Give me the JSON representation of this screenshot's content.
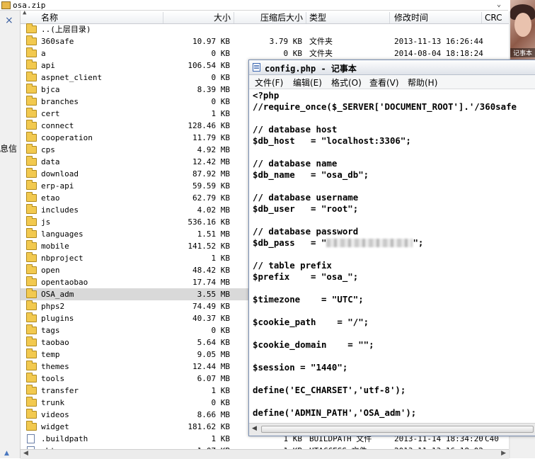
{
  "window": {
    "title": "osa.zip",
    "dropdown_icon": "chevron-down-icon"
  },
  "left_panel": {
    "close_glyph": "×",
    "partial_text": "息信",
    "arrow_glyph": "▲"
  },
  "header": {
    "up_glyph": "▲",
    "columns": [
      "名称",
      "大小",
      "压缩后大小",
      "类型",
      "修改时间",
      "CRC"
    ]
  },
  "rows": [
    {
      "name": "..(上层目录)",
      "size": "",
      "packed": "",
      "type": "",
      "mtime": "",
      "crc": ""
    },
    {
      "name": "360safe",
      "size": "10.97 KB",
      "packed": "3.79 KB",
      "type": "文件夹",
      "mtime": "2013-11-13 16:26:44",
      "crc": ""
    },
    {
      "name": "a",
      "size": "0 KB",
      "packed": "0 KB",
      "type": "文件夹",
      "mtime": "2014-08-04 18:18:24",
      "crc": ""
    },
    {
      "name": "api",
      "size": "106.54 KB",
      "packed": "",
      "type": "",
      "mtime": "",
      "crc": ""
    },
    {
      "name": "aspnet_client",
      "size": "0 KB",
      "packed": "",
      "type": "",
      "mtime": "",
      "crc": ""
    },
    {
      "name": "bjca",
      "size": "8.39 MB",
      "packed": "",
      "type": "",
      "mtime": "",
      "crc": ""
    },
    {
      "name": "branches",
      "size": "0 KB",
      "packed": "",
      "type": "",
      "mtime": "",
      "crc": ""
    },
    {
      "name": "cert",
      "size": "1 KB",
      "packed": "",
      "type": "",
      "mtime": "",
      "crc": ""
    },
    {
      "name": "connect",
      "size": "128.46 KB",
      "packed": "",
      "type": "",
      "mtime": "",
      "crc": ""
    },
    {
      "name": "cooperation",
      "size": "11.79 KB",
      "packed": "",
      "type": "",
      "mtime": "",
      "crc": ""
    },
    {
      "name": "cps",
      "size": "4.92 MB",
      "packed": "",
      "type": "",
      "mtime": "",
      "crc": ""
    },
    {
      "name": "data",
      "size": "12.42 MB",
      "packed": "",
      "type": "",
      "mtime": "",
      "crc": ""
    },
    {
      "name": "download",
      "size": "87.92 MB",
      "packed": "",
      "type": "",
      "mtime": "",
      "crc": ""
    },
    {
      "name": "erp-api",
      "size": "59.59 KB",
      "packed": "",
      "type": "",
      "mtime": "",
      "crc": ""
    },
    {
      "name": "etao",
      "size": "62.79 KB",
      "packed": "",
      "type": "",
      "mtime": "",
      "crc": ""
    },
    {
      "name": "includes",
      "size": "4.02 MB",
      "packed": "",
      "type": "",
      "mtime": "",
      "crc": ""
    },
    {
      "name": "js",
      "size": "536.16 KB",
      "packed": "",
      "type": "",
      "mtime": "",
      "crc": ""
    },
    {
      "name": "languages",
      "size": "1.51 MB",
      "packed": "",
      "type": "",
      "mtime": "",
      "crc": ""
    },
    {
      "name": "mobile",
      "size": "141.52 KB",
      "packed": "",
      "type": "",
      "mtime": "",
      "crc": ""
    },
    {
      "name": "nbproject",
      "size": "1 KB",
      "packed": "",
      "type": "",
      "mtime": "",
      "crc": ""
    },
    {
      "name": "open",
      "size": "48.42 KB",
      "packed": "",
      "type": "",
      "mtime": "",
      "crc": ""
    },
    {
      "name": "opentaobao",
      "size": "17.74 MB",
      "packed": "",
      "type": "",
      "mtime": "",
      "crc": ""
    },
    {
      "name": "OSA_adm",
      "size": "3.55 MB",
      "packed": "",
      "type": "",
      "mtime": "",
      "crc": "",
      "selected": true
    },
    {
      "name": "phps2",
      "size": "74.49 KB",
      "packed": "",
      "type": "",
      "mtime": "",
      "crc": ""
    },
    {
      "name": "plugins",
      "size": "40.37 KB",
      "packed": "",
      "type": "",
      "mtime": "",
      "crc": ""
    },
    {
      "name": "tags",
      "size": "0 KB",
      "packed": "",
      "type": "",
      "mtime": "",
      "crc": ""
    },
    {
      "name": "taobao",
      "size": "5.64 KB",
      "packed": "",
      "type": "",
      "mtime": "",
      "crc": ""
    },
    {
      "name": "temp",
      "size": "9.05 MB",
      "packed": "",
      "type": "",
      "mtime": "",
      "crc": ""
    },
    {
      "name": "themes",
      "size": "12.44 MB",
      "packed": "",
      "type": "",
      "mtime": "",
      "crc": ""
    },
    {
      "name": "tools",
      "size": "6.07 MB",
      "packed": "",
      "type": "",
      "mtime": "",
      "crc": ""
    },
    {
      "name": "transfer",
      "size": "1 KB",
      "packed": "",
      "type": "",
      "mtime": "",
      "crc": ""
    },
    {
      "name": "trunk",
      "size": "0 KB",
      "packed": "",
      "type": "",
      "mtime": "",
      "crc": ""
    },
    {
      "name": "videos",
      "size": "8.66 MB",
      "packed": "",
      "type": "",
      "mtime": "",
      "crc": ""
    },
    {
      "name": "widget",
      "size": "181.62 KB",
      "packed": "",
      "type": "",
      "mtime": "",
      "crc": ""
    },
    {
      "name": ".buildpath",
      "size": "1 KB",
      "packed": "1 KB",
      "type": "BUILDPATH 文件",
      "mtime": "2013-11-14 18:34:20",
      "crc": "C40",
      "file": true
    },
    {
      "name": ".ht",
      "size": "1.07 KB",
      "packed": "1 KB",
      "type": "HTACCESS 文件",
      "mtime": "2013-11-13 16:18:02",
      "crc": "",
      "file": true,
      "partial": true
    }
  ],
  "notepad": {
    "title": "config.php - 记事本",
    "menu": [
      "文件(F)",
      "编辑(E)",
      "格式(O)",
      "查看(V)",
      "帮助(H)"
    ],
    "lines": [
      "<?php",
      "//require_once($_SERVER['DOCUMENT_ROOT'].'/360safe",
      "",
      "// database host",
      "$db_host   = \"localhost:3306\";",
      "",
      "// database name",
      "$db_name   = \"osa_db\";",
      "",
      "// database username",
      "$db_user   = \"root\";",
      "",
      "// database password",
      "$db_pass   = \"",
      "",
      "// table prefix",
      "$prefix    = \"osa_\";",
      "",
      "$timezone    = \"UTC\";",
      "",
      "$cookie_path    = \"/\";",
      "",
      "$cookie_domain    = \"\";",
      "",
      "$session = \"1440\";",
      "",
      "define('EC_CHARSET','utf-8');",
      "",
      "define('ADMIN_PATH','OSA_adm');"
    ],
    "redacted_suffix": "\";",
    "redacted_line_index": 13
  },
  "side_photo": {
    "label": "记事本"
  }
}
